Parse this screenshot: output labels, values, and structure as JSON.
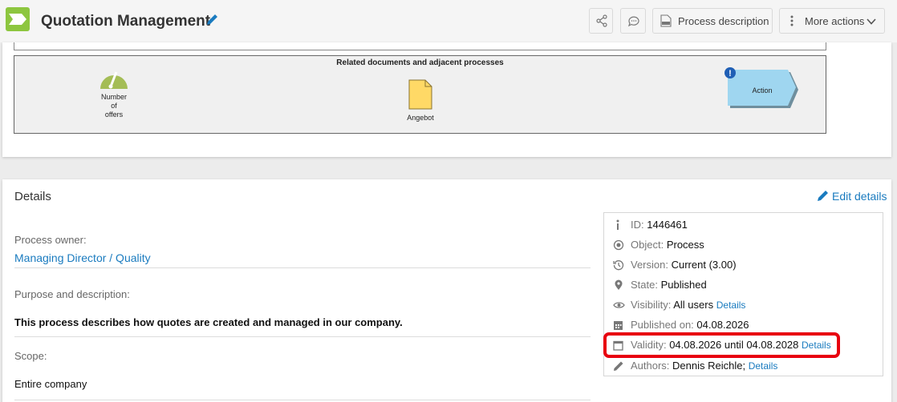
{
  "header": {
    "title": "Quotation Management",
    "process_description_label": "Process description",
    "more_actions_label": "More actions"
  },
  "diagram": {
    "lane_title": "Related documents and adjacent processes",
    "kpi_label": [
      "Number",
      "of",
      "offers"
    ],
    "document_label": "Angebot",
    "action_label": "Action"
  },
  "details": {
    "title": "Details",
    "edit_label": "Edit details",
    "process_owner_label": "Process owner:",
    "process_owner_value": "Managing Director / Quality",
    "purpose_label": "Purpose and description:",
    "purpose_value": "This process describes how quotes are created and managed in our company.",
    "scope_label": "Scope:",
    "scope_value": "Entire company"
  },
  "meta": {
    "id_label": "ID:",
    "id_value": "1446461",
    "object_label": "Object:",
    "object_value": "Process",
    "version_label": "Version:",
    "version_value": "Current (3.00)",
    "state_label": "State:",
    "state_value": "Published",
    "visibility_label": "Visibility:",
    "visibility_value": "All users",
    "visibility_details": "Details",
    "published_label": "Published on:",
    "published_value": "04.08.2026",
    "validity_label": "Validity:",
    "validity_value": "04.08.2026 until 04.08.2028",
    "validity_details": "Details",
    "authors_label": "Authors:",
    "authors_value": "Dennis Reichle;",
    "authors_details": "Details"
  },
  "colors": {
    "accent_link": "#1a7bbf",
    "logo_green": "#8dc63f",
    "document_yellow": "#ffd966",
    "action_blue": "#9fd6f0",
    "highlight_red": "#e8000f"
  }
}
